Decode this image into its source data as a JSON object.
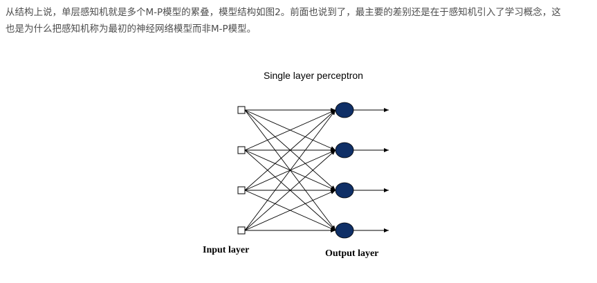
{
  "article": {
    "line1": "从结构上说，单层感知机就是多个M-P模型的累叠，模型结构如图2。前面也说到了，最主要的差别还是在于感知机引入了学习概念，这",
    "line2": "也是为什么把感知机称为最初的神经网络模型而非M-P模型。"
  },
  "figure": {
    "title": "Single layer perceptron",
    "input_label": "Input layer",
    "output_label": "Output layer",
    "input_count": 4,
    "output_count": 4,
    "node_color": "#0f2f66"
  }
}
